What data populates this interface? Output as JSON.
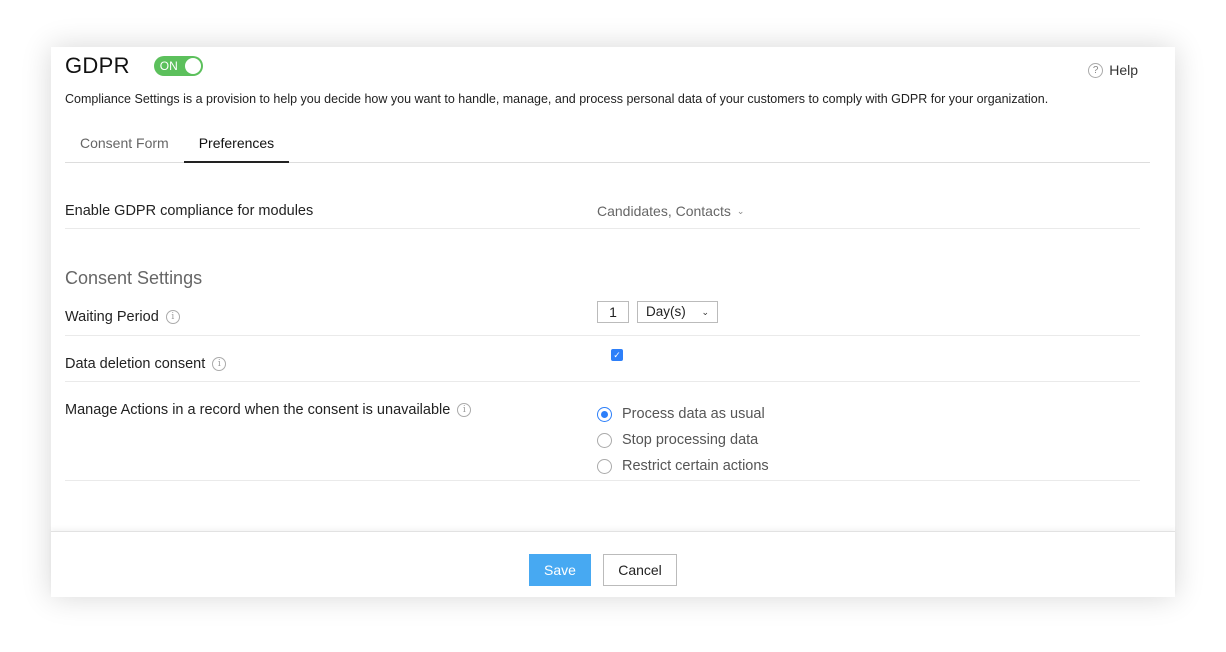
{
  "header": {
    "title": "GDPR",
    "toggle_label": "ON",
    "help_label": "Help",
    "help_icon": "?"
  },
  "description": "Compliance Settings is a provision to help you decide how you want to handle, manage, and process personal data of your customers to comply with GDPR for your organization.",
  "tabs": [
    {
      "label": "Consent Form",
      "active": false
    },
    {
      "label": "Preferences",
      "active": true
    }
  ],
  "modules": {
    "label": "Enable GDPR compliance for modules",
    "value": "Candidates, Contacts"
  },
  "consent_settings": {
    "title": "Consent Settings",
    "waiting_period": {
      "label": "Waiting Period",
      "value": "1",
      "unit": "Day(s)"
    },
    "data_deletion": {
      "label": "Data deletion consent",
      "checked": true
    },
    "manage_actions": {
      "label": "Manage Actions in a record when the consent is unavailable",
      "options": [
        {
          "label": "Process data as usual",
          "selected": true
        },
        {
          "label": "Stop processing data",
          "selected": false
        },
        {
          "label": "Restrict certain actions",
          "selected": false
        }
      ]
    }
  },
  "footer": {
    "save_label": "Save",
    "cancel_label": "Cancel"
  },
  "colors": {
    "toggle_on": "#5cc05c",
    "accent": "#2d7ff9",
    "save_button": "#47a9f2"
  },
  "icons": {
    "info": "info-icon",
    "chevron": "chevron-down-icon",
    "check": "check-icon"
  }
}
